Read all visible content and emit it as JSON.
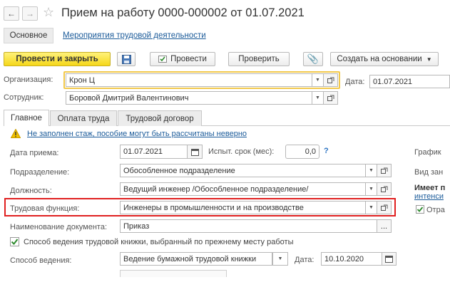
{
  "header": {
    "title": "Прием на работу 0000-000002 от 01.07.2021",
    "back_icon": "arrow-left-icon",
    "forward_icon": "arrow-right-icon",
    "favorite_icon": "star-icon"
  },
  "section_nav": {
    "main_label": "Основное",
    "activities_link": "Мероприятия трудовой деятельности"
  },
  "toolbar": {
    "post_and_close": "Провести и закрыть",
    "post": "Провести",
    "check": "Проверить",
    "create_based_on": "Создать на основании"
  },
  "organization": {
    "label": "Организация:",
    "value": "Крон Ц"
  },
  "date": {
    "label": "Дата:",
    "value": "01.07.2021"
  },
  "employee": {
    "label": "Сотрудник:",
    "value": "Боровой Дмитрий Валентинович"
  },
  "tabs": [
    {
      "label": "Главное"
    },
    {
      "label": "Оплата труда"
    },
    {
      "label": "Трудовой договор"
    }
  ],
  "warning": {
    "text": "Не заполнен стаж, пособие могут быть рассчитаны неверно"
  },
  "hire_date": {
    "label": "Дата приема:",
    "value": "01.07.2021"
  },
  "probation": {
    "label": "Испыт. срок (мес):",
    "value": "0,0",
    "help": "?"
  },
  "department": {
    "label": "Подразделение:",
    "value": "Обособленное подразделение"
  },
  "position": {
    "label": "Должность:",
    "value": "Ведущий инженер /Обособленное подразделение/"
  },
  "labor_function": {
    "label": "Трудовая функция:",
    "value": "Инженеры в промышленности и на производстве"
  },
  "document_name": {
    "label": "Наименование документа:",
    "value": "Приказ",
    "more": "..."
  },
  "workbook_checkbox": {
    "label": "Способ ведения трудовой книжки, выбранный по прежнему месту работы",
    "checked": true
  },
  "method": {
    "label": "Способ ведения:",
    "value": "Ведение бумажной трудовой книжки",
    "date_label": "Дата:",
    "date_value": "10.10.2020"
  },
  "right_panel": {
    "schedule": "График",
    "type": "Вид зан",
    "has": "Имеет п",
    "intensity": "интенси",
    "reflect": "Отра"
  },
  "colors": {
    "accent_yellow": "#f5d71a",
    "highlight_red": "#e02020",
    "link_blue": "#1a5a99",
    "warning_yellow": "#f2c200",
    "check_green": "#2e8b2e"
  }
}
